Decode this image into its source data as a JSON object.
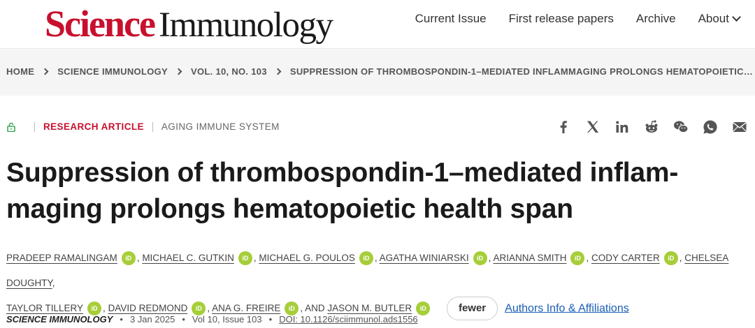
{
  "header": {
    "logo_science": "Science",
    "logo_immunology": "Immunology",
    "nav": [
      "Current Issue",
      "First release papers",
      "Archive"
    ],
    "about_label": "About"
  },
  "breadcrumb": [
    "HOME",
    "SCIENCE IMMUNOLOGY",
    "VOL. 10, NO. 103",
    "SUPPRESSION OF THROMBOSPONDIN-1–MEDIATED INFLAMMAGING PROLONGS HEMATOPOIETIC…"
  ],
  "article": {
    "type": "RESEARCH ARTICLE",
    "subject": "AGING IMMUNE SYSTEM",
    "title_line1": "Suppression of thrombospondin-1–mediated inflam-",
    "title_line2": "maging prolongs hematopoietic health span"
  },
  "share_icons": [
    "facebook-icon",
    "x-icon",
    "linkedin-icon",
    "reddit-icon",
    "wechat-icon",
    "whatsapp-icon",
    "email-icon"
  ],
  "authors": [
    "PRADEEP RAMALINGAM",
    "MICHAEL C. GUTKIN",
    "MICHAEL G. POULOS",
    "AGATHA WINIARSKI",
    "ARIANNA SMITH",
    "CODY CARTER",
    "CHELSEA DOUGHTY",
    "TAYLOR TILLERY",
    "DAVID REDMOND",
    "ANA G. FREIRE",
    "JASON M. BUTLER"
  ],
  "authors_and": ", AND",
  "orcid_label": "iD",
  "fewer_label": "fewer",
  "affiliations_label": "Authors Info & Affiliations",
  "journal": {
    "name": "SCIENCE IMMUNOLOGY",
    "date": "3 Jan 2025",
    "issue": "Vol 10, Issue 103",
    "doi": "DOI: 10.1126/sciimmunol.ads1556"
  },
  "colors": {
    "brand_red": "#c8102e",
    "orcid_green": "#a6ce39",
    "link_blue": "#1a5fb4"
  }
}
